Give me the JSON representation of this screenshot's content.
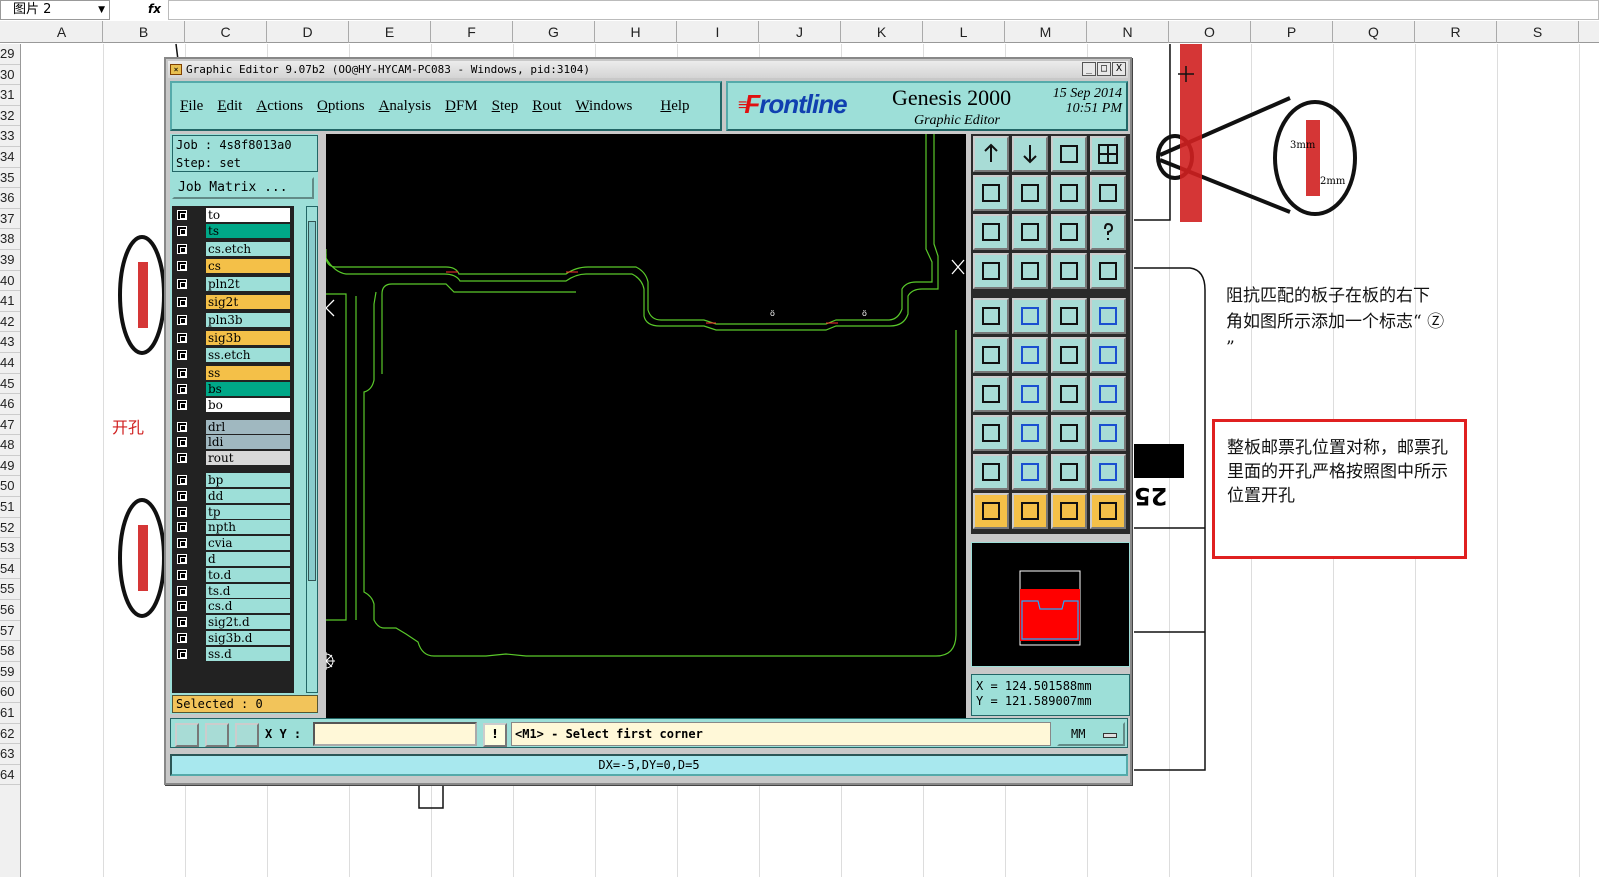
{
  "excel": {
    "namebox": "图片 2",
    "fx": "fx",
    "columns": [
      "A",
      "B",
      "C",
      "D",
      "E",
      "F",
      "G",
      "H",
      "I",
      "J",
      "K",
      "L",
      "M",
      "N",
      "O",
      "P",
      "Q",
      "R",
      "S"
    ],
    "rows": [
      "29",
      "30",
      "31",
      "32",
      "33",
      "34",
      "35",
      "36",
      "37",
      "38",
      "39",
      "40",
      "41",
      "42",
      "43",
      "44",
      "45",
      "46",
      "47",
      "48",
      "49",
      "50",
      "51",
      "52",
      "53",
      "54",
      "55",
      "56",
      "57",
      "58",
      "59",
      "60",
      "61",
      "62",
      "63",
      "64"
    ]
  },
  "annotations": {
    "note_top": "阻抗匹配的板子在板的右下角如图所示添加一个标志“ Ⓩ ”",
    "callout": "整板邮票孔位置对称，邮票孔里面的开孔严格按照图中所示位置开孔",
    "left_label": "开孔",
    "dim_a": "3mm",
    "dim_b": "2mm",
    "fragment": "25"
  },
  "window": {
    "title": "Graphic Editor 9.07b2 (OO@HY-HYCAM-PC083 - Windows, pid:3104)",
    "controls": [
      "_",
      "□",
      "X"
    ]
  },
  "menu": {
    "items": [
      {
        "label": "File"
      },
      {
        "label": "Edit"
      },
      {
        "label": "Actions"
      },
      {
        "label": "Options"
      },
      {
        "label": "Analysis"
      },
      {
        "label": "DFM"
      },
      {
        "label": "Step"
      },
      {
        "label": "Rout"
      },
      {
        "label": "Windows"
      },
      {
        "label": "Help"
      }
    ]
  },
  "brand": {
    "logo_first": "F",
    "logo_rest": "rontline",
    "product": "Genesis 2000",
    "subtitle": "Graphic Editor",
    "date": "15 Sep 2014",
    "time": "10:51 PM"
  },
  "job": {
    "job_line": "Job : 4s8f8013a0",
    "step_line": "Step: set",
    "matrix_button": "Job Matrix ..."
  },
  "layers": [
    {
      "name": "to",
      "color": "#ffffff"
    },
    {
      "name": "ts",
      "color": "#00a888"
    },
    {
      "name": "cs.etch",
      "color": "#9ddfd8"
    },
    {
      "name": "cs",
      "color": "#f4c048"
    },
    {
      "name": "pln2t",
      "color": "#9ddfd8"
    },
    {
      "name": "sig2t",
      "color": "#f4c048"
    },
    {
      "name": "pln3b",
      "color": "#9ddfd8"
    },
    {
      "name": "sig3b",
      "color": "#f4c048"
    },
    {
      "name": "ss.etch",
      "color": "#9ddfd8"
    },
    {
      "name": "ss",
      "color": "#f4c048"
    },
    {
      "name": "bs",
      "color": "#00a888"
    },
    {
      "name": "bo",
      "color": "#ffffff"
    },
    {
      "name": "drl",
      "color": "#a0b8c0"
    },
    {
      "name": "ldi",
      "color": "#a0b8c0"
    },
    {
      "name": "rout",
      "color": "#d8d8d8"
    },
    {
      "name": "bp",
      "color": "#9ddfd8"
    },
    {
      "name": "dd",
      "color": "#9ddfd8"
    },
    {
      "name": "tp",
      "color": "#9ddfd8"
    },
    {
      "name": "npth",
      "color": "#9ddfd8"
    },
    {
      "name": "cvia",
      "color": "#9ddfd8"
    },
    {
      "name": "d",
      "color": "#9ddfd8"
    },
    {
      "name": "to.d",
      "color": "#9ddfd8"
    },
    {
      "name": "ts.d",
      "color": "#9ddfd8"
    },
    {
      "name": "cs.d",
      "color": "#9ddfd8"
    },
    {
      "name": "sig2t.d",
      "color": "#9ddfd8"
    },
    {
      "name": "sig3b.d",
      "color": "#9ddfd8"
    },
    {
      "name": "ss.d",
      "color": "#9ddfd8"
    }
  ],
  "selected_text": "Selected : 0",
  "coords": {
    "x": "X = 124.501588mm",
    "y": "Y = 121.589007mm"
  },
  "bottom": {
    "xy_label": "X Y :",
    "xy_value": "",
    "warn": "!",
    "prompt": "<M1> - Select first corner",
    "unit": "MM"
  },
  "status": "DX=-5,DY=0,D=5",
  "tools": [
    "up-icon",
    "down-icon",
    "home-icon",
    "frame-icon",
    "left-arrow-icon",
    "right-arrow-icon",
    "undo-icon",
    "redo-icon",
    "zoom-fit-icon",
    "zoom-all-icon",
    "scale-1-2-icon",
    "help-icon",
    "snap-settings-icon",
    "probe-icon",
    "connect-icon",
    "connect-red-icon",
    "pad-icon",
    "corner-icon",
    "ruler-icon",
    "dash-circle-icon",
    "line-nodes-icon",
    "cross-icon",
    "arrow-icon",
    "arrow2-icon",
    "angle-icon",
    "slash-icon",
    "rotate-icon",
    "mirror-icon",
    "move-icon",
    "minus-icon",
    "measure-icon",
    "copy-icon",
    "triangle-icon",
    "tri-arrow-icon",
    "tri-a-icon",
    "tri-b-icon",
    "select-icon",
    "select2-icon",
    "select3-icon",
    "select4-icon"
  ]
}
